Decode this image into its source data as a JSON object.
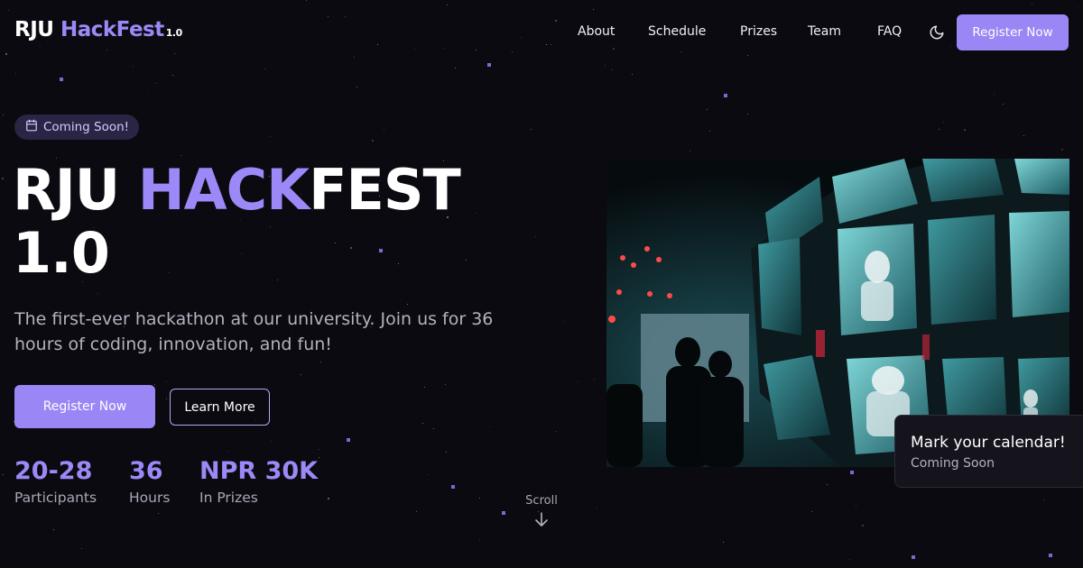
{
  "nav": {
    "logo": {
      "part1": "RJU",
      "part2": "HackFest",
      "version": "1.0"
    },
    "links": [
      "About",
      "Schedule",
      "Prizes",
      "Team",
      "FAQ"
    ],
    "theme_icon": "moon-icon",
    "cta": "Register Now"
  },
  "hero": {
    "badge": {
      "icon": "calendar-icon",
      "label": "Coming Soon!"
    },
    "title": {
      "part1": "RJU ",
      "highlight": "HACK",
      "part2": "FEST",
      "line2": "1.0"
    },
    "subtitle": "The first-ever hackathon at our university. Join us for 36 hours of coding, innovation, and fun!",
    "primary_cta": "Register Now",
    "secondary_cta": "Learn More",
    "stats": [
      {
        "value": "20-28",
        "label": "Participants"
      },
      {
        "value": "36",
        "label": "Hours"
      },
      {
        "value": "NPR 30K",
        "label": "In Prizes"
      }
    ],
    "scroll_label": "Scroll",
    "scroll_icon": "arrow-down-icon"
  },
  "card": {
    "title": "Mark your calendar!",
    "subtitle": "Coming Soon"
  },
  "colors": {
    "background": "#0b0a10",
    "accent": "#9a86f5",
    "text_muted": "#b4b1c0"
  }
}
